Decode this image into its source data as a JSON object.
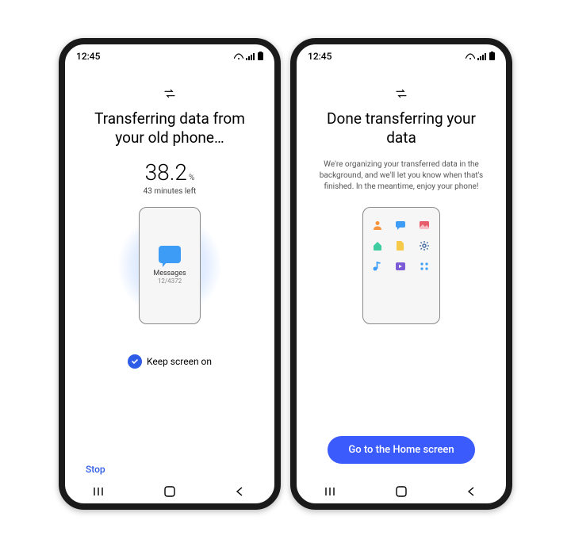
{
  "status": {
    "time": "12:45"
  },
  "left": {
    "title": "Transferring data from your old phone…",
    "percent": "38.2",
    "percent_symbol": "%",
    "time_left": "43 minutes left",
    "current_item_label": "Messages",
    "current_item_count": "12/4372",
    "keep_screen_label": "Keep screen on",
    "stop_label": "Stop"
  },
  "right": {
    "title": "Done transferring your data",
    "subtext": "We're organizing your transferred data in the background, and we'll let you know when that's finished. In the meantime, enjoy your phone!",
    "home_button": "Go to the Home screen",
    "icons": [
      "person",
      "message",
      "image",
      "home",
      "file",
      "settings",
      "music",
      "video",
      "apps"
    ]
  },
  "colors": {
    "accent": "#3b5bfd",
    "link": "#2e5ce6",
    "blue_light": "#3d9cf5"
  }
}
